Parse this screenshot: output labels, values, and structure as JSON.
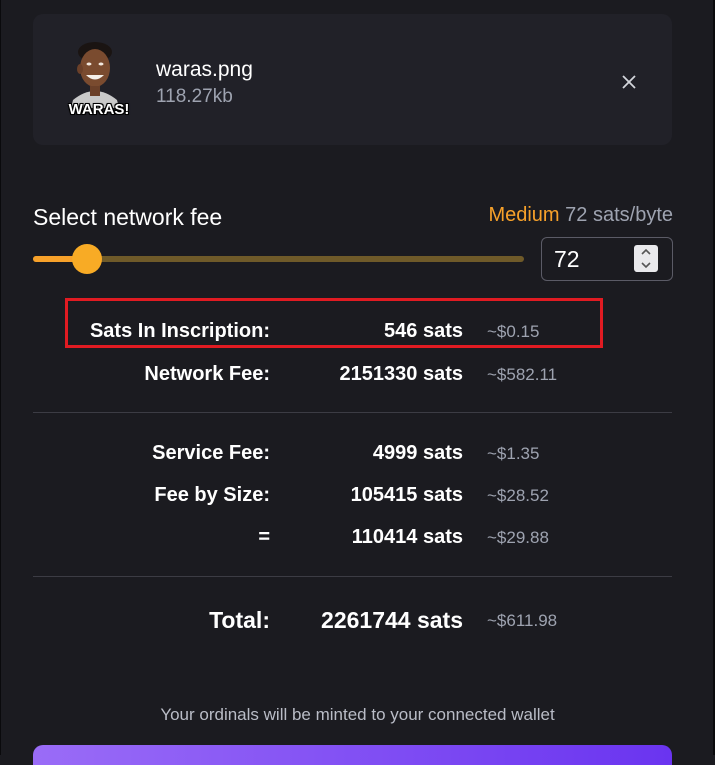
{
  "file": {
    "name": "waras.png",
    "size": "118.27kb",
    "thumb_caption": "WARAS!"
  },
  "fee": {
    "title": "Select network fee",
    "level": "Medium",
    "rate": "72 sats/byte",
    "value": "72",
    "slider_fraction": 0.11
  },
  "rows": [
    {
      "label": "Sats In Inscription:",
      "value": "546 sats",
      "usd": "~$0.15"
    },
    {
      "label": "Network Fee:",
      "value": "2151330 sats",
      "usd": "~$582.11"
    },
    {
      "label": "Service Fee:",
      "value": "4999 sats",
      "usd": "~$1.35"
    },
    {
      "label": "Fee by Size:",
      "value": "105415 sats",
      "usd": "~$28.52"
    },
    {
      "label": "=",
      "value": "110414 sats",
      "usd": "~$29.88"
    }
  ],
  "total": {
    "label": "Total:",
    "value": "2261744 sats",
    "usd": "~$611.98"
  },
  "mint_note": "Your ordinals will be minted to your connected wallet",
  "colors": {
    "background": "#1b1b20",
    "card": "#212128",
    "accent": "#f7a12a",
    "muted": "#9ea3b0",
    "highlight": "#e11b22",
    "button_gradient_start": "#9a6cf7",
    "button_gradient_end": "#6a34f0"
  }
}
